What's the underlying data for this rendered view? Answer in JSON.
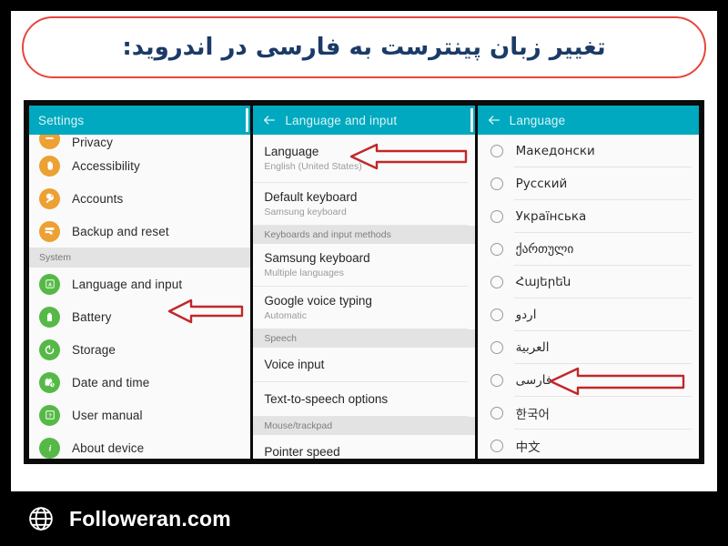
{
  "title": {
    "text": "تغییر زبان پینترست به فارسی در اندروید:",
    "border_color": "#e8453c",
    "text_color": "#1b3a67"
  },
  "theme": {
    "appbar_color": "#00a9bf",
    "amber_icon": "#eda033",
    "green_icon": "#56b947",
    "arrow_color": "#c0282a",
    "frame_color": "#0a0a0a"
  },
  "panels": {
    "settings": {
      "appbar_title": "Settings",
      "has_back": false,
      "items": [
        {
          "label": "Privacy",
          "icon": "privacy-icon",
          "color": "amber",
          "clipped": true
        },
        {
          "label": "Accessibility",
          "icon": "accessibility-hand-icon",
          "color": "amber",
          "clipped": false
        },
        {
          "label": "Accounts",
          "icon": "accounts-key-icon",
          "color": "amber",
          "clipped": false
        },
        {
          "label": "Backup and reset",
          "icon": "backup-reset-icon",
          "color": "amber",
          "clipped": false
        }
      ],
      "section_label": "System",
      "system_items": [
        {
          "label": "Language and input",
          "icon": "language-input-icon",
          "color": "green"
        },
        {
          "label": "Battery",
          "icon": "battery-icon",
          "color": "green"
        },
        {
          "label": "Storage",
          "icon": "storage-icon",
          "color": "green"
        },
        {
          "label": "Date and time",
          "icon": "date-time-icon",
          "color": "green"
        },
        {
          "label": "User manual",
          "icon": "user-manual-icon",
          "color": "green"
        },
        {
          "label": "About device",
          "icon": "about-device-icon",
          "color": "green"
        }
      ]
    },
    "language_and_input": {
      "appbar_title": "Language and input",
      "has_back": true,
      "rows": [
        {
          "kind": "item",
          "title": "Language",
          "subtitle": "English (United States)"
        },
        {
          "kind": "item",
          "title": "Default keyboard",
          "subtitle": "Samsung keyboard"
        },
        {
          "kind": "header",
          "title": "Keyboards and input methods"
        },
        {
          "kind": "item",
          "title": "Samsung keyboard",
          "subtitle": "Multiple languages"
        },
        {
          "kind": "item",
          "title": "Google voice typing",
          "subtitle": "Automatic"
        },
        {
          "kind": "header",
          "title": "Speech"
        },
        {
          "kind": "item",
          "title": "Voice input",
          "subtitle": ""
        },
        {
          "kind": "item",
          "title": "Text-to-speech options",
          "subtitle": ""
        },
        {
          "kind": "header",
          "title": "Mouse/trackpad"
        },
        {
          "kind": "item",
          "title": "Pointer speed",
          "subtitle": ""
        }
      ]
    },
    "language": {
      "appbar_title": "Language",
      "has_back": true,
      "languages": [
        {
          "name": "Македонски",
          "rtl": false,
          "selected": false
        },
        {
          "name": "Русский",
          "rtl": false,
          "selected": false
        },
        {
          "name": "Українська",
          "rtl": false,
          "selected": false
        },
        {
          "name": "ქართული",
          "rtl": false,
          "selected": false
        },
        {
          "name": "Հայերեն",
          "rtl": false,
          "selected": false
        },
        {
          "name": "اردو",
          "rtl": true,
          "selected": false
        },
        {
          "name": "العربية",
          "rtl": true,
          "selected": false
        },
        {
          "name": "فارسی",
          "rtl": true,
          "selected": false
        },
        {
          "name": "한국어",
          "rtl": false,
          "selected": false
        },
        {
          "name": "中文",
          "rtl": false,
          "selected": false
        }
      ]
    }
  },
  "annotations": {
    "arrow_settings_language": "points at Language and input",
    "arrow_language_row": "points at Language",
    "arrow_farsi": "points at فارسی"
  },
  "footer": {
    "brand": "Followeran.com",
    "icon": "globe-icon"
  }
}
